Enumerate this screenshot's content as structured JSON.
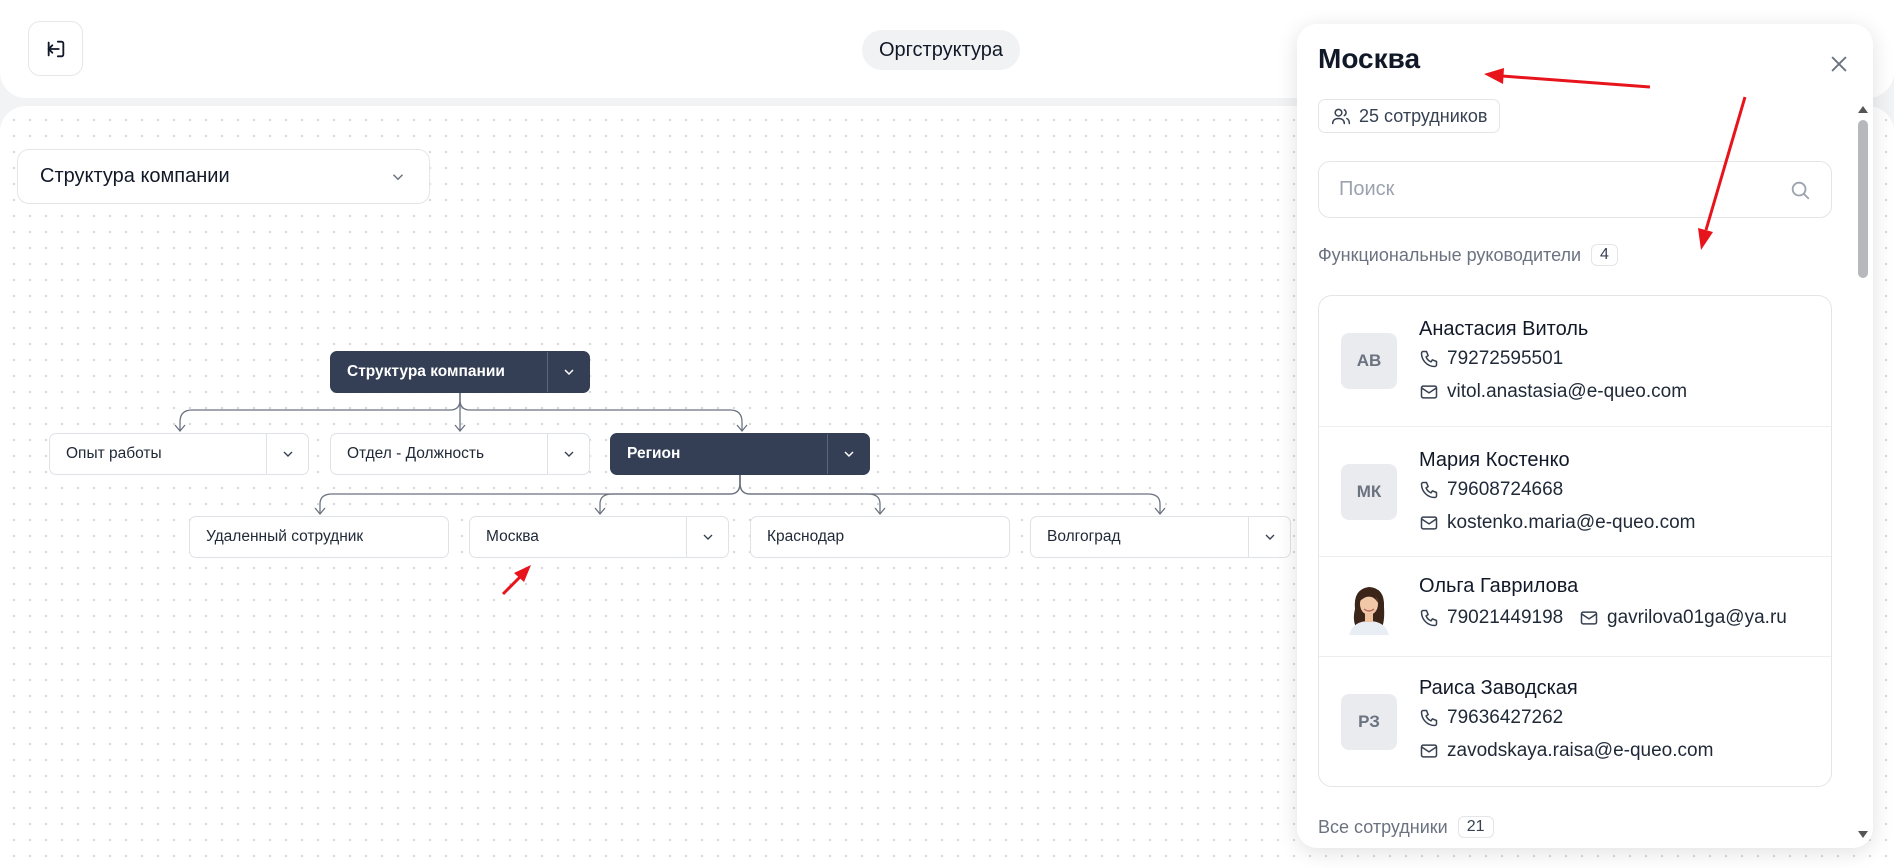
{
  "header": {
    "title": "Оргструктура",
    "back_icon": "exit-left-icon"
  },
  "canvas": {
    "structure_select": {
      "value": "Структура компании"
    },
    "nodes": {
      "root": "Структура компании",
      "experience": "Опыт работы",
      "department": "Отдел - Должность",
      "region": "Регион",
      "remote": "Удаленный сотрудник",
      "moscow": "Москва",
      "krasnodar": "Краснодар",
      "volgograd": "Волгоград"
    },
    "colors": {
      "dark_node": "#343e54",
      "annotation_arrow": "#e8141b"
    }
  },
  "panel": {
    "title": "Москва",
    "employees_chip": "25 сотрудников",
    "search_placeholder": "Поиск",
    "managers_section": {
      "label": "Функциональные руководители",
      "count": "4"
    },
    "managers": [
      {
        "initials": "АВ",
        "name": "Анастасия Витоль",
        "phone": "79272595501",
        "email": "vitol.anastasia@e-queo.com"
      },
      {
        "initials": "МК",
        "name": "Мария Костенко",
        "phone": "79608724668",
        "email": "kostenko.maria@e-queo.com"
      },
      {
        "initials": "",
        "name": "Ольга Гаврилова",
        "phone": "79021449198",
        "email": "gavrilova01ga@ya.ru"
      },
      {
        "initials": "РЗ",
        "name": "Раиса Заводская",
        "phone": "79636427262",
        "email": "zavodskaya.raisa@e-queo.com"
      }
    ],
    "all_section": {
      "label": "Все сотрудники",
      "count": "21"
    }
  }
}
